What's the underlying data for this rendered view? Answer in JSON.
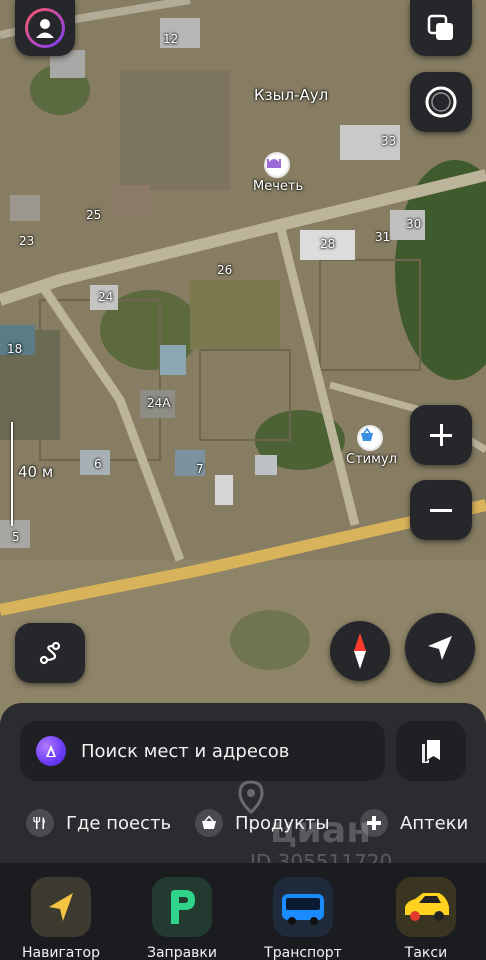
{
  "map": {
    "village_name": "Кзыл-Аул",
    "house_numbers": [
      "12",
      "25",
      "23",
      "33",
      "30",
      "31",
      "28",
      "26",
      "24",
      "18",
      "24А",
      "6",
      "7",
      "5"
    ],
    "pois": [
      {
        "name": "Мечеть",
        "icon": "mosque-icon"
      },
      {
        "name": "Стимул",
        "icon": "shopping-basket-icon"
      }
    ],
    "scale_label": "40 м"
  },
  "controls": {
    "profile": "avatar-icon",
    "layers": "layers-icon",
    "alice": "alice-icon",
    "zoom_in": "plus-icon",
    "zoom_out": "minus-icon",
    "route": "route-icon",
    "compass": "compass-icon",
    "my_location": "location-arrow-icon"
  },
  "search": {
    "placeholder": "Поиск мест и адресов"
  },
  "categories": [
    {
      "label": "Где поесть",
      "icon": "fork-knife-icon"
    },
    {
      "label": "Продукты",
      "icon": "basket-icon"
    },
    {
      "label": "Аптеки",
      "icon": "plus-cross-icon"
    }
  ],
  "tabs": [
    {
      "label": "Навигатор",
      "icon": "navigator-icon",
      "color": "#f6c443"
    },
    {
      "label": "Заправки",
      "icon": "fuel-icon",
      "color": "#2fd48a"
    },
    {
      "label": "Транспорт",
      "icon": "bus-icon",
      "color": "#1a8cff"
    },
    {
      "label": "Такси",
      "icon": "taxi-icon",
      "color": "#ffd21f"
    }
  ],
  "watermark": {
    "brand": "циан",
    "id_text": "ID 305511720"
  }
}
